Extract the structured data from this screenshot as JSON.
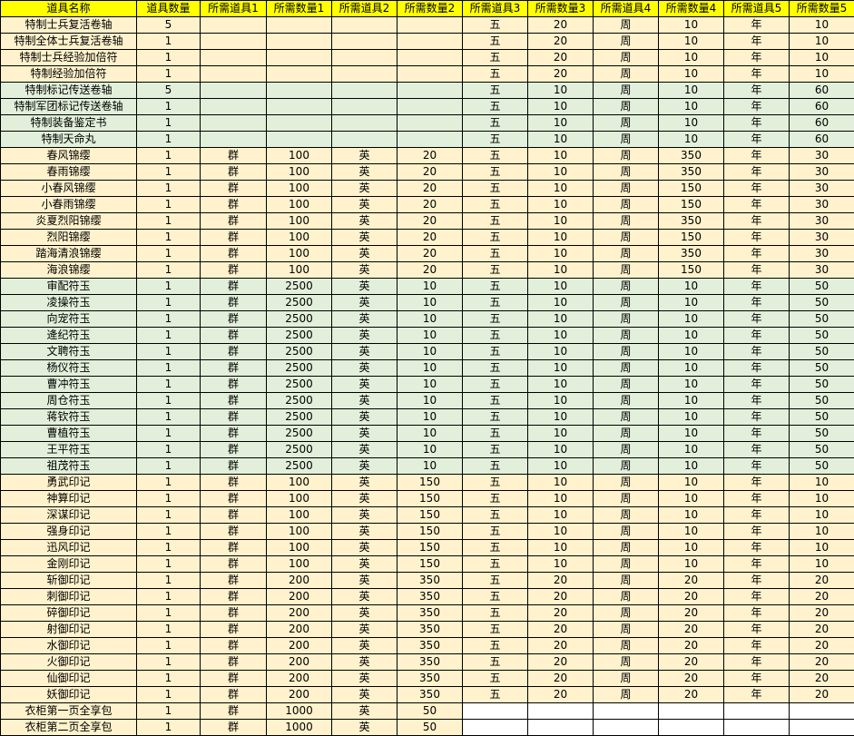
{
  "colors": {
    "header_fill": "#ffff00",
    "band_cream": "#fff2cc",
    "band_green": "#e2efda",
    "border": "#000000"
  },
  "columns": [
    "道具名称",
    "道具数量",
    "所需道具1",
    "所需数量1",
    "所需道具2",
    "所需数量2",
    "所需道具3",
    "所需数量3",
    "所需道具4",
    "所需数量4",
    "所需道具5",
    "所需数量5"
  ],
  "rows": [
    {
      "band": "a",
      "cells": [
        "特制士兵复活卷轴",
        "5",
        "",
        "",
        "",
        "",
        "五",
        "20",
        "周",
        "10",
        "年",
        "10"
      ]
    },
    {
      "band": "a",
      "cells": [
        "特制全体士兵复活卷轴",
        "1",
        "",
        "",
        "",
        "",
        "五",
        "20",
        "周",
        "10",
        "年",
        "10"
      ]
    },
    {
      "band": "a",
      "cells": [
        "特制士兵经验加倍符",
        "1",
        "",
        "",
        "",
        "",
        "五",
        "20",
        "周",
        "10",
        "年",
        "10"
      ]
    },
    {
      "band": "a",
      "cells": [
        "特制经验加倍符",
        "1",
        "",
        "",
        "",
        "",
        "五",
        "20",
        "周",
        "10",
        "年",
        "10"
      ]
    },
    {
      "band": "b",
      "cells": [
        "特制标记传送卷轴",
        "5",
        "",
        "",
        "",
        "",
        "五",
        "10",
        "周",
        "10",
        "年",
        "60"
      ]
    },
    {
      "band": "b",
      "cells": [
        "特制军团标记传送卷轴",
        "1",
        "",
        "",
        "",
        "",
        "五",
        "10",
        "周",
        "10",
        "年",
        "60"
      ]
    },
    {
      "band": "b",
      "cells": [
        "特制装备鉴定书",
        "1",
        "",
        "",
        "",
        "",
        "五",
        "10",
        "周",
        "10",
        "年",
        "60"
      ]
    },
    {
      "band": "b",
      "cells": [
        "特制天命丸",
        "1",
        "",
        "",
        "",
        "",
        "五",
        "10",
        "周",
        "10",
        "年",
        "60"
      ]
    },
    {
      "band": "a",
      "cells": [
        "春风锦缨",
        "1",
        "群",
        "100",
        "英",
        "20",
        "五",
        "10",
        "周",
        "350",
        "年",
        "30"
      ]
    },
    {
      "band": "a",
      "cells": [
        "春雨锦缨",
        "1",
        "群",
        "100",
        "英",
        "20",
        "五",
        "10",
        "周",
        "350",
        "年",
        "30"
      ]
    },
    {
      "band": "a",
      "cells": [
        "小春风锦缨",
        "1",
        "群",
        "100",
        "英",
        "20",
        "五",
        "10",
        "周",
        "150",
        "年",
        "30"
      ]
    },
    {
      "band": "a",
      "cells": [
        "小春雨锦缨",
        "1",
        "群",
        "100",
        "英",
        "20",
        "五",
        "10",
        "周",
        "150",
        "年",
        "30"
      ]
    },
    {
      "band": "a",
      "cells": [
        "炎夏烈阳锦缨",
        "1",
        "群",
        "100",
        "英",
        "20",
        "五",
        "10",
        "周",
        "350",
        "年",
        "30"
      ]
    },
    {
      "band": "a",
      "cells": [
        "烈阳锦缨",
        "1",
        "群",
        "100",
        "英",
        "20",
        "五",
        "10",
        "周",
        "150",
        "年",
        "30"
      ]
    },
    {
      "band": "a",
      "cells": [
        "踏海清浪锦缨",
        "1",
        "群",
        "100",
        "英",
        "20",
        "五",
        "10",
        "周",
        "350",
        "年",
        "30"
      ]
    },
    {
      "band": "a",
      "cells": [
        "海浪锦缨",
        "1",
        "群",
        "100",
        "英",
        "20",
        "五",
        "10",
        "周",
        "150",
        "年",
        "30"
      ]
    },
    {
      "band": "b",
      "cells": [
        "审配符玉",
        "1",
        "群",
        "2500",
        "英",
        "10",
        "五",
        "10",
        "周",
        "10",
        "年",
        "50"
      ]
    },
    {
      "band": "b",
      "cells": [
        "凌操符玉",
        "1",
        "群",
        "2500",
        "英",
        "10",
        "五",
        "10",
        "周",
        "10",
        "年",
        "50"
      ]
    },
    {
      "band": "b",
      "cells": [
        "向宠符玉",
        "1",
        "群",
        "2500",
        "英",
        "10",
        "五",
        "10",
        "周",
        "10",
        "年",
        "50"
      ]
    },
    {
      "band": "b",
      "cells": [
        "逄纪符玉",
        "1",
        "群",
        "2500",
        "英",
        "10",
        "五",
        "10",
        "周",
        "10",
        "年",
        "50"
      ]
    },
    {
      "band": "b",
      "cells": [
        "文聘符玉",
        "1",
        "群",
        "2500",
        "英",
        "10",
        "五",
        "10",
        "周",
        "10",
        "年",
        "50"
      ]
    },
    {
      "band": "b",
      "cells": [
        "杨仪符玉",
        "1",
        "群",
        "2500",
        "英",
        "10",
        "五",
        "10",
        "周",
        "10",
        "年",
        "50"
      ]
    },
    {
      "band": "b",
      "cells": [
        "曹冲符玉",
        "1",
        "群",
        "2500",
        "英",
        "10",
        "五",
        "10",
        "周",
        "10",
        "年",
        "50"
      ]
    },
    {
      "band": "b",
      "cells": [
        "周仓符玉",
        "1",
        "群",
        "2500",
        "英",
        "10",
        "五",
        "10",
        "周",
        "10",
        "年",
        "50"
      ]
    },
    {
      "band": "b",
      "cells": [
        "蒋钦符玉",
        "1",
        "群",
        "2500",
        "英",
        "10",
        "五",
        "10",
        "周",
        "10",
        "年",
        "50"
      ]
    },
    {
      "band": "b",
      "cells": [
        "曹植符玉",
        "1",
        "群",
        "2500",
        "英",
        "10",
        "五",
        "10",
        "周",
        "10",
        "年",
        "50"
      ]
    },
    {
      "band": "b",
      "cells": [
        "王平符玉",
        "1",
        "群",
        "2500",
        "英",
        "10",
        "五",
        "10",
        "周",
        "10",
        "年",
        "50"
      ]
    },
    {
      "band": "b",
      "cells": [
        "祖茂符玉",
        "1",
        "群",
        "2500",
        "英",
        "10",
        "五",
        "10",
        "周",
        "10",
        "年",
        "50"
      ]
    },
    {
      "band": "a",
      "cells": [
        "勇武印记",
        "1",
        "群",
        "100",
        "英",
        "150",
        "五",
        "10",
        "周",
        "10",
        "年",
        "10"
      ]
    },
    {
      "band": "a",
      "cells": [
        "神算印记",
        "1",
        "群",
        "100",
        "英",
        "150",
        "五",
        "10",
        "周",
        "10",
        "年",
        "10"
      ]
    },
    {
      "band": "a",
      "cells": [
        "深谋印记",
        "1",
        "群",
        "100",
        "英",
        "150",
        "五",
        "10",
        "周",
        "10",
        "年",
        "10"
      ]
    },
    {
      "band": "a",
      "cells": [
        "强身印记",
        "1",
        "群",
        "100",
        "英",
        "150",
        "五",
        "10",
        "周",
        "10",
        "年",
        "10"
      ]
    },
    {
      "band": "a",
      "cells": [
        "迅风印记",
        "1",
        "群",
        "100",
        "英",
        "150",
        "五",
        "10",
        "周",
        "10",
        "年",
        "10"
      ]
    },
    {
      "band": "a",
      "cells": [
        "金刚印记",
        "1",
        "群",
        "100",
        "英",
        "150",
        "五",
        "10",
        "周",
        "10",
        "年",
        "10"
      ]
    },
    {
      "band": "a",
      "cells": [
        "斩御印记",
        "1",
        "群",
        "200",
        "英",
        "350",
        "五",
        "20",
        "周",
        "20",
        "年",
        "20"
      ]
    },
    {
      "band": "a",
      "cells": [
        "刺御印记",
        "1",
        "群",
        "200",
        "英",
        "350",
        "五",
        "20",
        "周",
        "20",
        "年",
        "20"
      ]
    },
    {
      "band": "a",
      "cells": [
        "碎御印记",
        "1",
        "群",
        "200",
        "英",
        "350",
        "五",
        "20",
        "周",
        "20",
        "年",
        "20"
      ]
    },
    {
      "band": "a",
      "cells": [
        "射御印记",
        "1",
        "群",
        "200",
        "英",
        "350",
        "五",
        "20",
        "周",
        "20",
        "年",
        "20"
      ]
    },
    {
      "band": "a",
      "cells": [
        "水御印记",
        "1",
        "群",
        "200",
        "英",
        "350",
        "五",
        "20",
        "周",
        "20",
        "年",
        "20"
      ]
    },
    {
      "band": "a",
      "cells": [
        "火御印记",
        "1",
        "群",
        "200",
        "英",
        "350",
        "五",
        "20",
        "周",
        "20",
        "年",
        "20"
      ]
    },
    {
      "band": "a",
      "cells": [
        "仙御印记",
        "1",
        "群",
        "200",
        "英",
        "350",
        "五",
        "20",
        "周",
        "20",
        "年",
        "20"
      ]
    },
    {
      "band": "a",
      "cells": [
        "妖御印记",
        "1",
        "群",
        "200",
        "英",
        "350",
        "五",
        "20",
        "周",
        "20",
        "年",
        "20"
      ]
    },
    {
      "band": "w",
      "cells": [
        "衣柜第一页全享包",
        "1",
        "群",
        "1000",
        "英",
        "50",
        "",
        "",
        "",
        "",
        "",
        ""
      ]
    },
    {
      "band": "w",
      "cells": [
        "衣柜第二页全享包",
        "1",
        "群",
        "1000",
        "英",
        "50",
        "",
        "",
        "",
        "",
        "",
        ""
      ]
    }
  ]
}
